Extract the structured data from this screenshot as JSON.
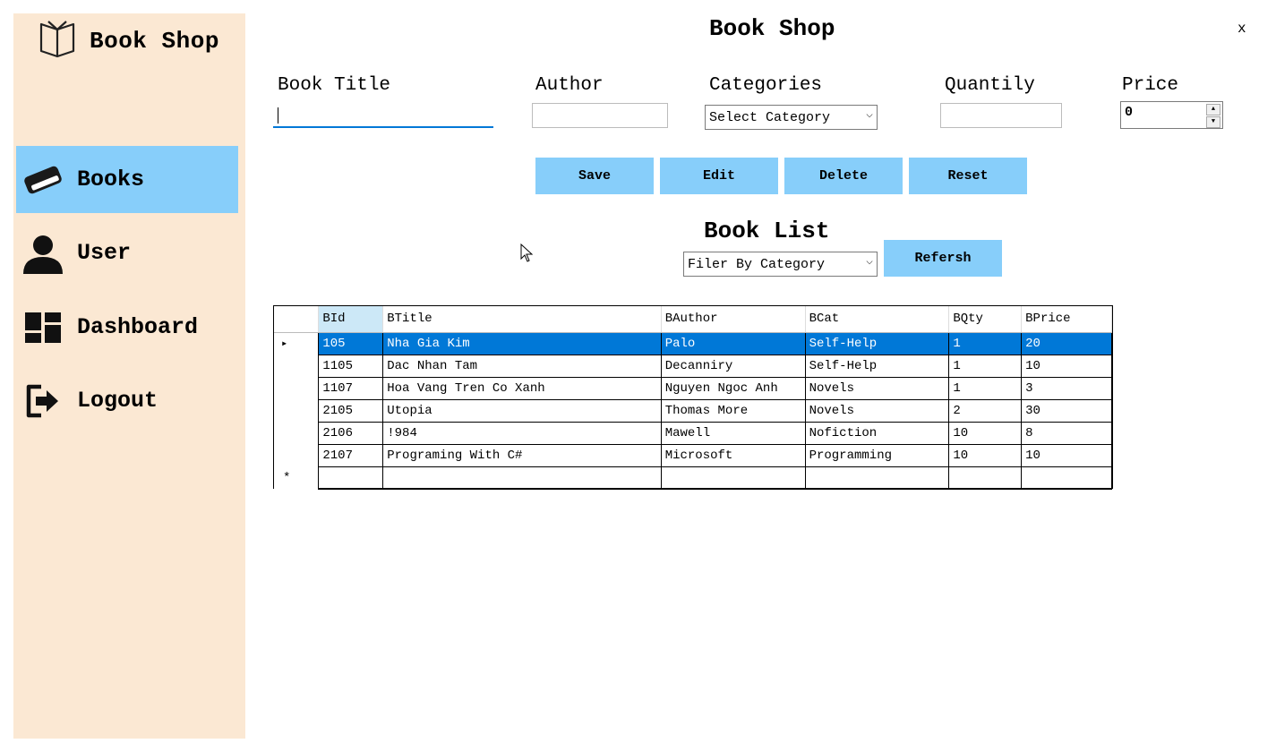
{
  "sidebar": {
    "brand": "Book Shop",
    "items": [
      {
        "label": "Books",
        "icon": "book-icon",
        "active": true
      },
      {
        "label": "User",
        "icon": "user-icon",
        "active": false
      },
      {
        "label": "Dashboard",
        "icon": "dashboard-icon",
        "active": false
      },
      {
        "label": "Logout",
        "icon": "logout-icon",
        "active": false
      }
    ]
  },
  "header": {
    "title": "Book Shop",
    "close": "x"
  },
  "form": {
    "title_label": "Book Title",
    "title_value": "",
    "author_label": "Author",
    "author_value": "",
    "category_label": "Categories",
    "category_selected": "Select Category",
    "quantity_label": "Quantily",
    "quantity_value": "",
    "price_label": "Price",
    "price_value": "0"
  },
  "actions": {
    "save": "Save",
    "edit": "Edit",
    "delete": "Delete",
    "reset": "Reset"
  },
  "list": {
    "title": "Book List",
    "filter_selected": "Filer By Category",
    "refresh": "Refersh"
  },
  "grid": {
    "columns": [
      "BId",
      "BTitle",
      "BAuthor",
      "BCat",
      "BQty",
      "BPrice"
    ],
    "rows": [
      [
        "105",
        "Nha Gia Kim",
        "Palo",
        "Self-Help",
        "1",
        "20"
      ],
      [
        "1105",
        "Dac Nhan Tam",
        "Decanniry",
        "Self-Help",
        "1",
        "10"
      ],
      [
        "1107",
        "Hoa Vang Tren Co Xanh",
        "Nguyen Ngoc Anh",
        "Novels",
        "1",
        "3"
      ],
      [
        "2105",
        "Utopia",
        "Thomas More",
        "Novels",
        "2",
        "30"
      ],
      [
        "2106",
        "!984",
        "Mawell",
        "Nofiction",
        "10",
        "8"
      ],
      [
        "2107",
        "Programing With C#",
        "Microsoft",
        "Programming",
        "10",
        "10"
      ]
    ],
    "selected_row": 0,
    "new_row_marker": "*",
    "current_row_marker": "▸"
  },
  "colors": {
    "sidebar_bg": "#fbe8d3",
    "accent": "#87cefa",
    "selection": "#0078d7"
  }
}
